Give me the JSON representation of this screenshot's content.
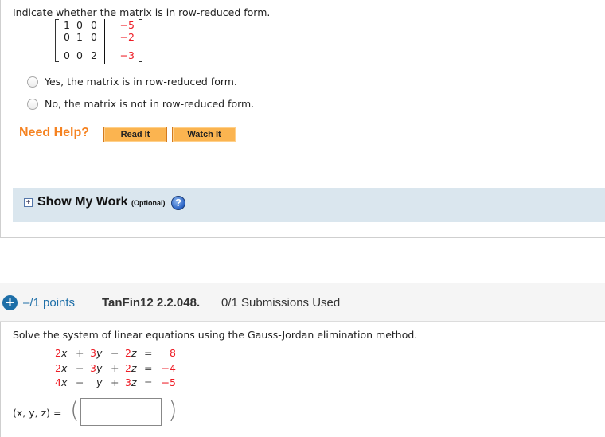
{
  "question1": {
    "prompt": "Indicate whether the matrix is in row-reduced form.",
    "matrix": {
      "rows": [
        {
          "cells": [
            "1",
            "0",
            "0"
          ],
          "augmented": "−5"
        },
        {
          "cells": [
            "0",
            "1",
            "0"
          ],
          "augmented": "−2"
        },
        {
          "cells": [
            "0",
            "0",
            "2"
          ],
          "augmented": "−3"
        }
      ]
    },
    "options": [
      {
        "label": "Yes, the matrix is in row-reduced form.",
        "selected": false
      },
      {
        "label": "No, the matrix is not in row-reduced form.",
        "selected": false
      }
    ],
    "need_help": {
      "label": "Need Help?",
      "buttons": [
        "Read It",
        "Watch It"
      ]
    },
    "show_my_work": {
      "expand_icon": "plus-box-icon",
      "title": "Show My Work",
      "optional": "(Optional)",
      "help_icon": "question-mark-icon",
      "help_glyph": "?"
    }
  },
  "question2": {
    "header": {
      "expand_icon": "plus-circle-icon",
      "expand_glyph": "+",
      "points": "–/1 points",
      "problem_id": "TanFin12 2.2.048.",
      "submissions": "0/1 Submissions Used"
    },
    "prompt": "Solve the system of linear equations using the Gauss-Jordan elimination method.",
    "equations": [
      {
        "x_coef": "2",
        "op1": "+",
        "y_coef": "3",
        "op2": "−",
        "z_coef": "2",
        "rhs": "8"
      },
      {
        "x_coef": "2",
        "op1": "−",
        "y_coef": "3",
        "op2": "+",
        "z_coef": "2",
        "rhs": "−4"
      },
      {
        "x_coef": "4",
        "op1": "−",
        "y_coef": "",
        "op2": "+",
        "z_coef": "3",
        "rhs": "−5"
      }
    ],
    "variables": {
      "x": "x",
      "y": "y",
      "z": "z",
      "equals": "="
    },
    "answer": {
      "label": "(x, y, z) =",
      "open_paren": "(",
      "close_paren": ")",
      "value": ""
    }
  },
  "colors": {
    "accent_orange": "#f58220",
    "coefficient_red": "#ee1c25",
    "points_blue": "#1e6fa8",
    "panel_blue": "#dae6ee",
    "button_orange": "#fbb450"
  }
}
